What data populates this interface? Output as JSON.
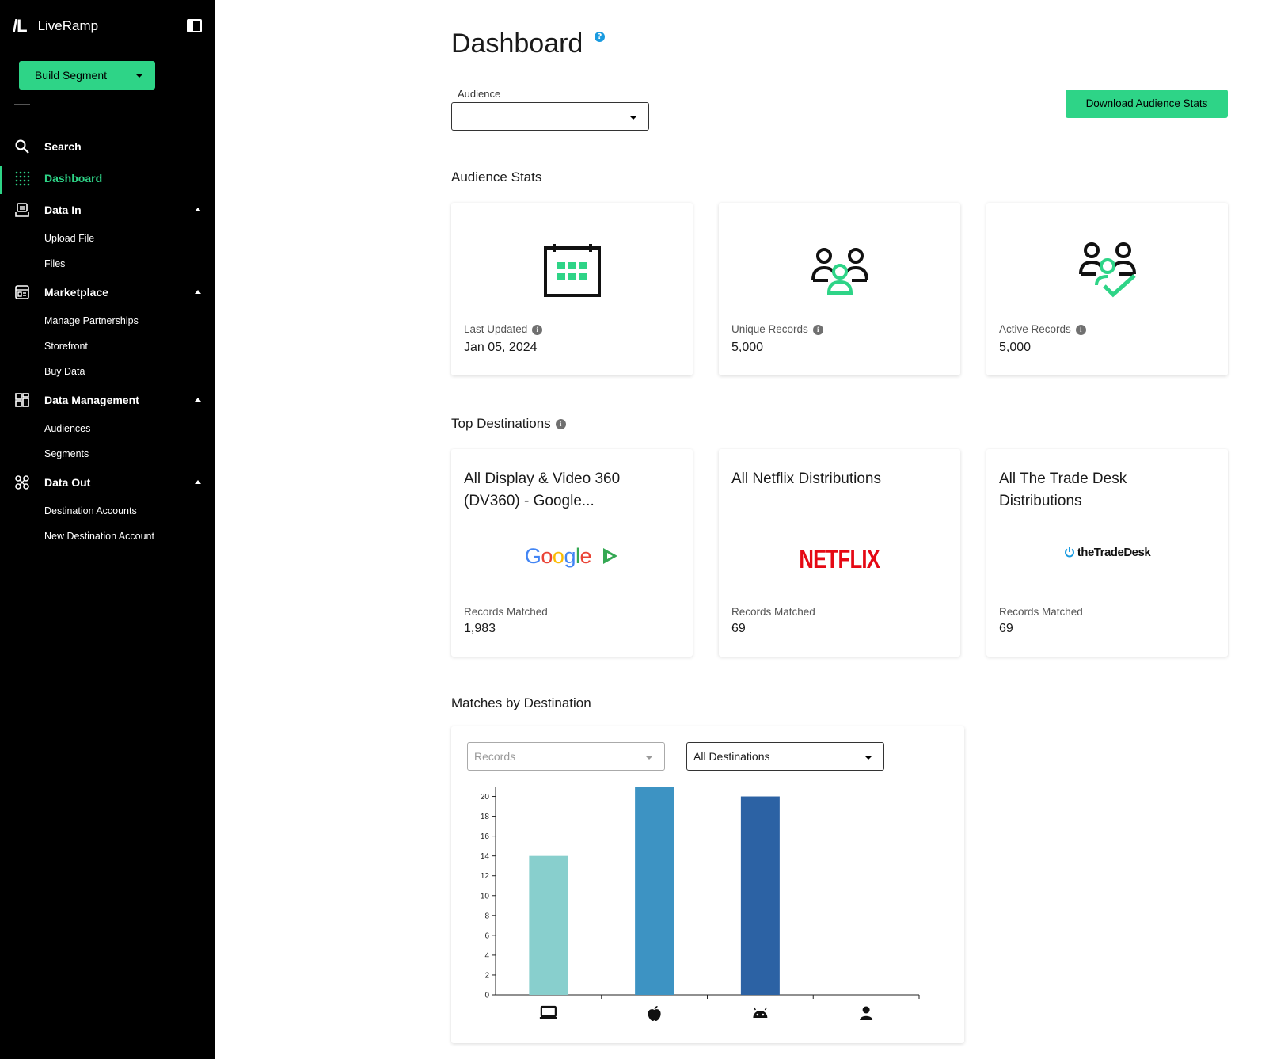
{
  "app": {
    "brand_mark": "/L",
    "brand_name": "LiveRamp"
  },
  "sidebar": {
    "build_segment_label": "Build Segment",
    "nav": [
      {
        "key": "search",
        "label": "Search",
        "active": false
      },
      {
        "key": "dashboard",
        "label": "Dashboard",
        "active": true
      },
      {
        "key": "data-in",
        "label": "Data In",
        "expanded": true,
        "children": [
          "Upload File",
          "Files"
        ]
      },
      {
        "key": "marketplace",
        "label": "Marketplace",
        "expanded": true,
        "children": [
          "Manage Partnerships",
          "Storefront",
          "Buy Data"
        ]
      },
      {
        "key": "data-management",
        "label": "Data Management",
        "expanded": true,
        "children": [
          "Audiences",
          "Segments"
        ]
      },
      {
        "key": "data-out",
        "label": "Data Out",
        "expanded": true,
        "children": [
          "Destination Accounts",
          "New Destination Account"
        ]
      }
    ]
  },
  "header": {
    "title": "Dashboard",
    "help_glyph": "?",
    "audience_label": "Audience",
    "audience_value": "",
    "download_label": "Download Audience Stats"
  },
  "audience_stats": {
    "title": "Audience Stats",
    "cards": [
      {
        "label": "Last Updated",
        "value": "Jan 05, 2024",
        "icon": "calendar-icon"
      },
      {
        "label": "Unique Records",
        "value": "5,000",
        "icon": "users-group-icon"
      },
      {
        "label": "Active Records",
        "value": "5,000",
        "icon": "users-check-icon"
      }
    ]
  },
  "top_destinations": {
    "title": "Top Destinations",
    "cards": [
      {
        "name": "All Display & Video 360 (DV360) - Google...",
        "logo": "Google",
        "label": "Records Matched",
        "value": "1,983"
      },
      {
        "name": "All Netflix Distributions",
        "logo": "NETFLIX",
        "label": "Records Matched",
        "value": "69"
      },
      {
        "name": "All The Trade Desk Distributions",
        "logo": "theTradeDesk",
        "label": "Records Matched",
        "value": "69"
      }
    ]
  },
  "matches": {
    "title": "Matches by Destination",
    "metric_placeholder": "Records",
    "destination_value": "All Destinations"
  },
  "chart_data": {
    "type": "bar",
    "categories": [
      "desktop-icon",
      "apple-icon",
      "android-icon",
      "person-icon"
    ],
    "values": [
      14,
      21,
      20,
      0
    ],
    "colors": [
      "#88cfcd",
      "#3d93c3",
      "#2c62a4",
      "#2c62a4"
    ],
    "ylim": [
      0,
      21
    ],
    "yticks": [
      0,
      2,
      4,
      6,
      8,
      10,
      12,
      14,
      16,
      18,
      20
    ],
    "xlabel": "",
    "ylabel": ""
  }
}
